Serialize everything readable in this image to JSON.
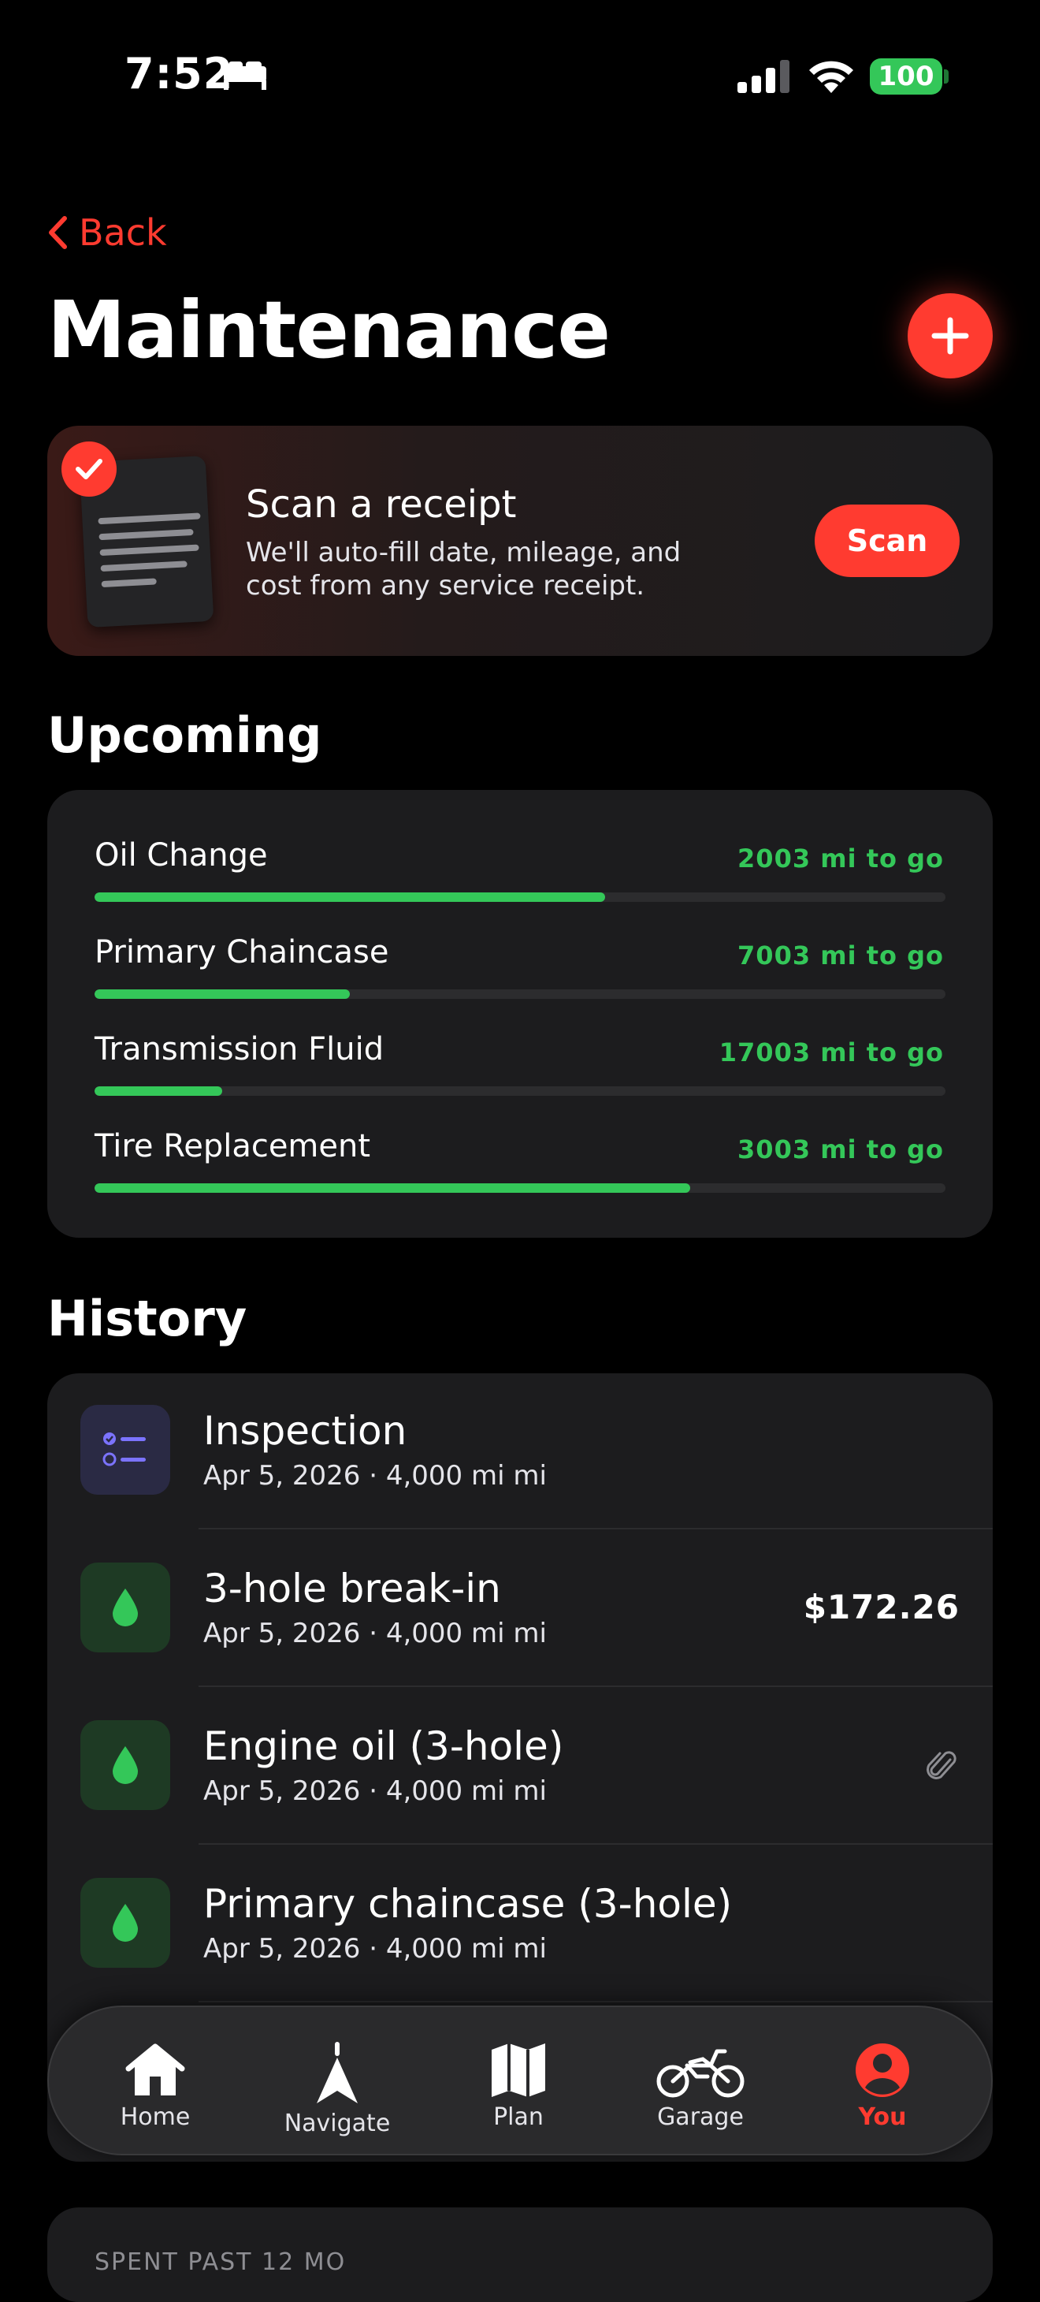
{
  "status_bar": {
    "time": "7:52",
    "battery": "100"
  },
  "nav": {
    "back_label": "Back",
    "title": "Maintenance"
  },
  "scan_card": {
    "title": "Scan a receipt",
    "description": "We'll auto-fill date, mileage, and cost from any service receipt.",
    "button_label": "Scan"
  },
  "upcoming": {
    "heading": "Upcoming",
    "items": [
      {
        "name": "Oil Change",
        "remaining": "2003 mi to go",
        "progress": 0.6
      },
      {
        "name": "Primary Chaincase",
        "remaining": "7003 mi to go",
        "progress": 0.3
      },
      {
        "name": "Transmission Fluid",
        "remaining": "17003 mi to go",
        "progress": 0.15
      },
      {
        "name": "Tire Replacement",
        "remaining": "3003 mi to go",
        "progress": 0.7
      }
    ]
  },
  "history": {
    "heading": "History",
    "items": [
      {
        "title": "Inspection",
        "subtitle": "Apr 5, 2026 · 4,000 mi mi",
        "icon": "checklist-icon",
        "cost": ""
      },
      {
        "title": "3-hole break-in",
        "subtitle": "Apr 5, 2026 · 4,000 mi mi",
        "icon": "oil-drop-icon",
        "cost": "$172.26"
      },
      {
        "title": "Engine oil (3-hole)",
        "subtitle": "Apr 5, 2026 · 4,000 mi mi",
        "icon": "oil-drop-icon",
        "cost": ""
      },
      {
        "title": "Primary chaincase (3-hole)",
        "subtitle": "Apr 5, 2026 · 4,000 mi mi",
        "icon": "oil-drop-icon",
        "cost": ""
      }
    ]
  },
  "tabs": [
    {
      "label": "Home",
      "icon": "house-icon",
      "active": false
    },
    {
      "label": "Navigate",
      "icon": "navigate-arrow-icon",
      "active": false
    },
    {
      "label": "Plan",
      "icon": "map-icon",
      "active": false
    },
    {
      "label": "Garage",
      "icon": "motorcycle-icon",
      "active": false
    },
    {
      "label": "You",
      "icon": "person-icon",
      "active": true
    }
  ],
  "bottom_peek": "SPENT PAST 12 MO",
  "colors": {
    "accent": "#ff3b30",
    "success": "#34c759",
    "background": "#000000",
    "card": "#1c1c1e"
  }
}
